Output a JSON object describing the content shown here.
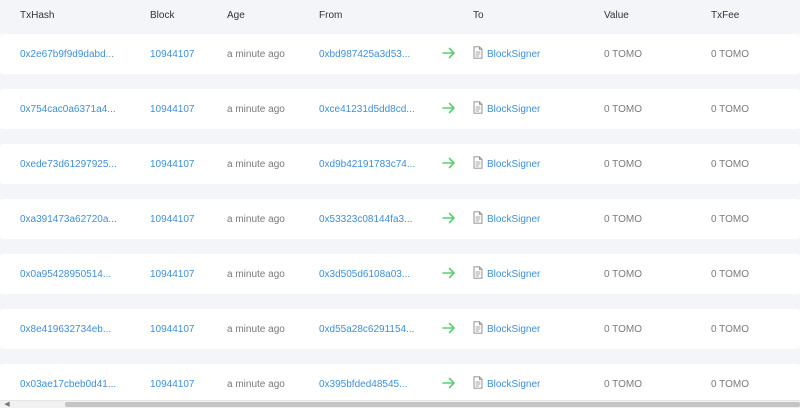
{
  "columns": {
    "txhash": "TxHash",
    "block": "Block",
    "age": "Age",
    "from": "From",
    "to": "To",
    "value": "Value",
    "txfee": "TxFee"
  },
  "icons": {
    "direction": "right-arrow-icon",
    "contract": "document-icon"
  },
  "colors": {
    "link": "#3f8fd8",
    "arrow": "#5ccf76"
  },
  "rows": [
    {
      "txhash": "0x2e67b9f9d9dabd...",
      "block": "10944107",
      "age": "a minute ago",
      "from": "0xbd987425a3d53...",
      "to": "BlockSigner",
      "value": "0 TOMO",
      "txfee": "0 TOMO"
    },
    {
      "txhash": "0x754cac0a6371a4...",
      "block": "10944107",
      "age": "a minute ago",
      "from": "0xce41231d5dd8cd...",
      "to": "BlockSigner",
      "value": "0 TOMO",
      "txfee": "0 TOMO"
    },
    {
      "txhash": "0xede73d61297925...",
      "block": "10944107",
      "age": "a minute ago",
      "from": "0xd9b42191783c74...",
      "to": "BlockSigner",
      "value": "0 TOMO",
      "txfee": "0 TOMO"
    },
    {
      "txhash": "0xa391473a62720a...",
      "block": "10944107",
      "age": "a minute ago",
      "from": "0x53323c08144fa3...",
      "to": "BlockSigner",
      "value": "0 TOMO",
      "txfee": "0 TOMO"
    },
    {
      "txhash": "0x0a95428950514...",
      "block": "10944107",
      "age": "a minute ago",
      "from": "0x3d505d6108a03...",
      "to": "BlockSigner",
      "value": "0 TOMO",
      "txfee": "0 TOMO"
    },
    {
      "txhash": "0x8e419632734eb...",
      "block": "10944107",
      "age": "a minute ago",
      "from": "0xd55a28c6291154...",
      "to": "BlockSigner",
      "value": "0 TOMO",
      "txfee": "0 TOMO"
    },
    {
      "txhash": "0x03ae17cbeb0d41...",
      "block": "10944107",
      "age": "a minute ago",
      "from": "0x395bfded48545...",
      "to": "BlockSigner",
      "value": "0 TOMO",
      "txfee": "0 TOMO"
    }
  ]
}
